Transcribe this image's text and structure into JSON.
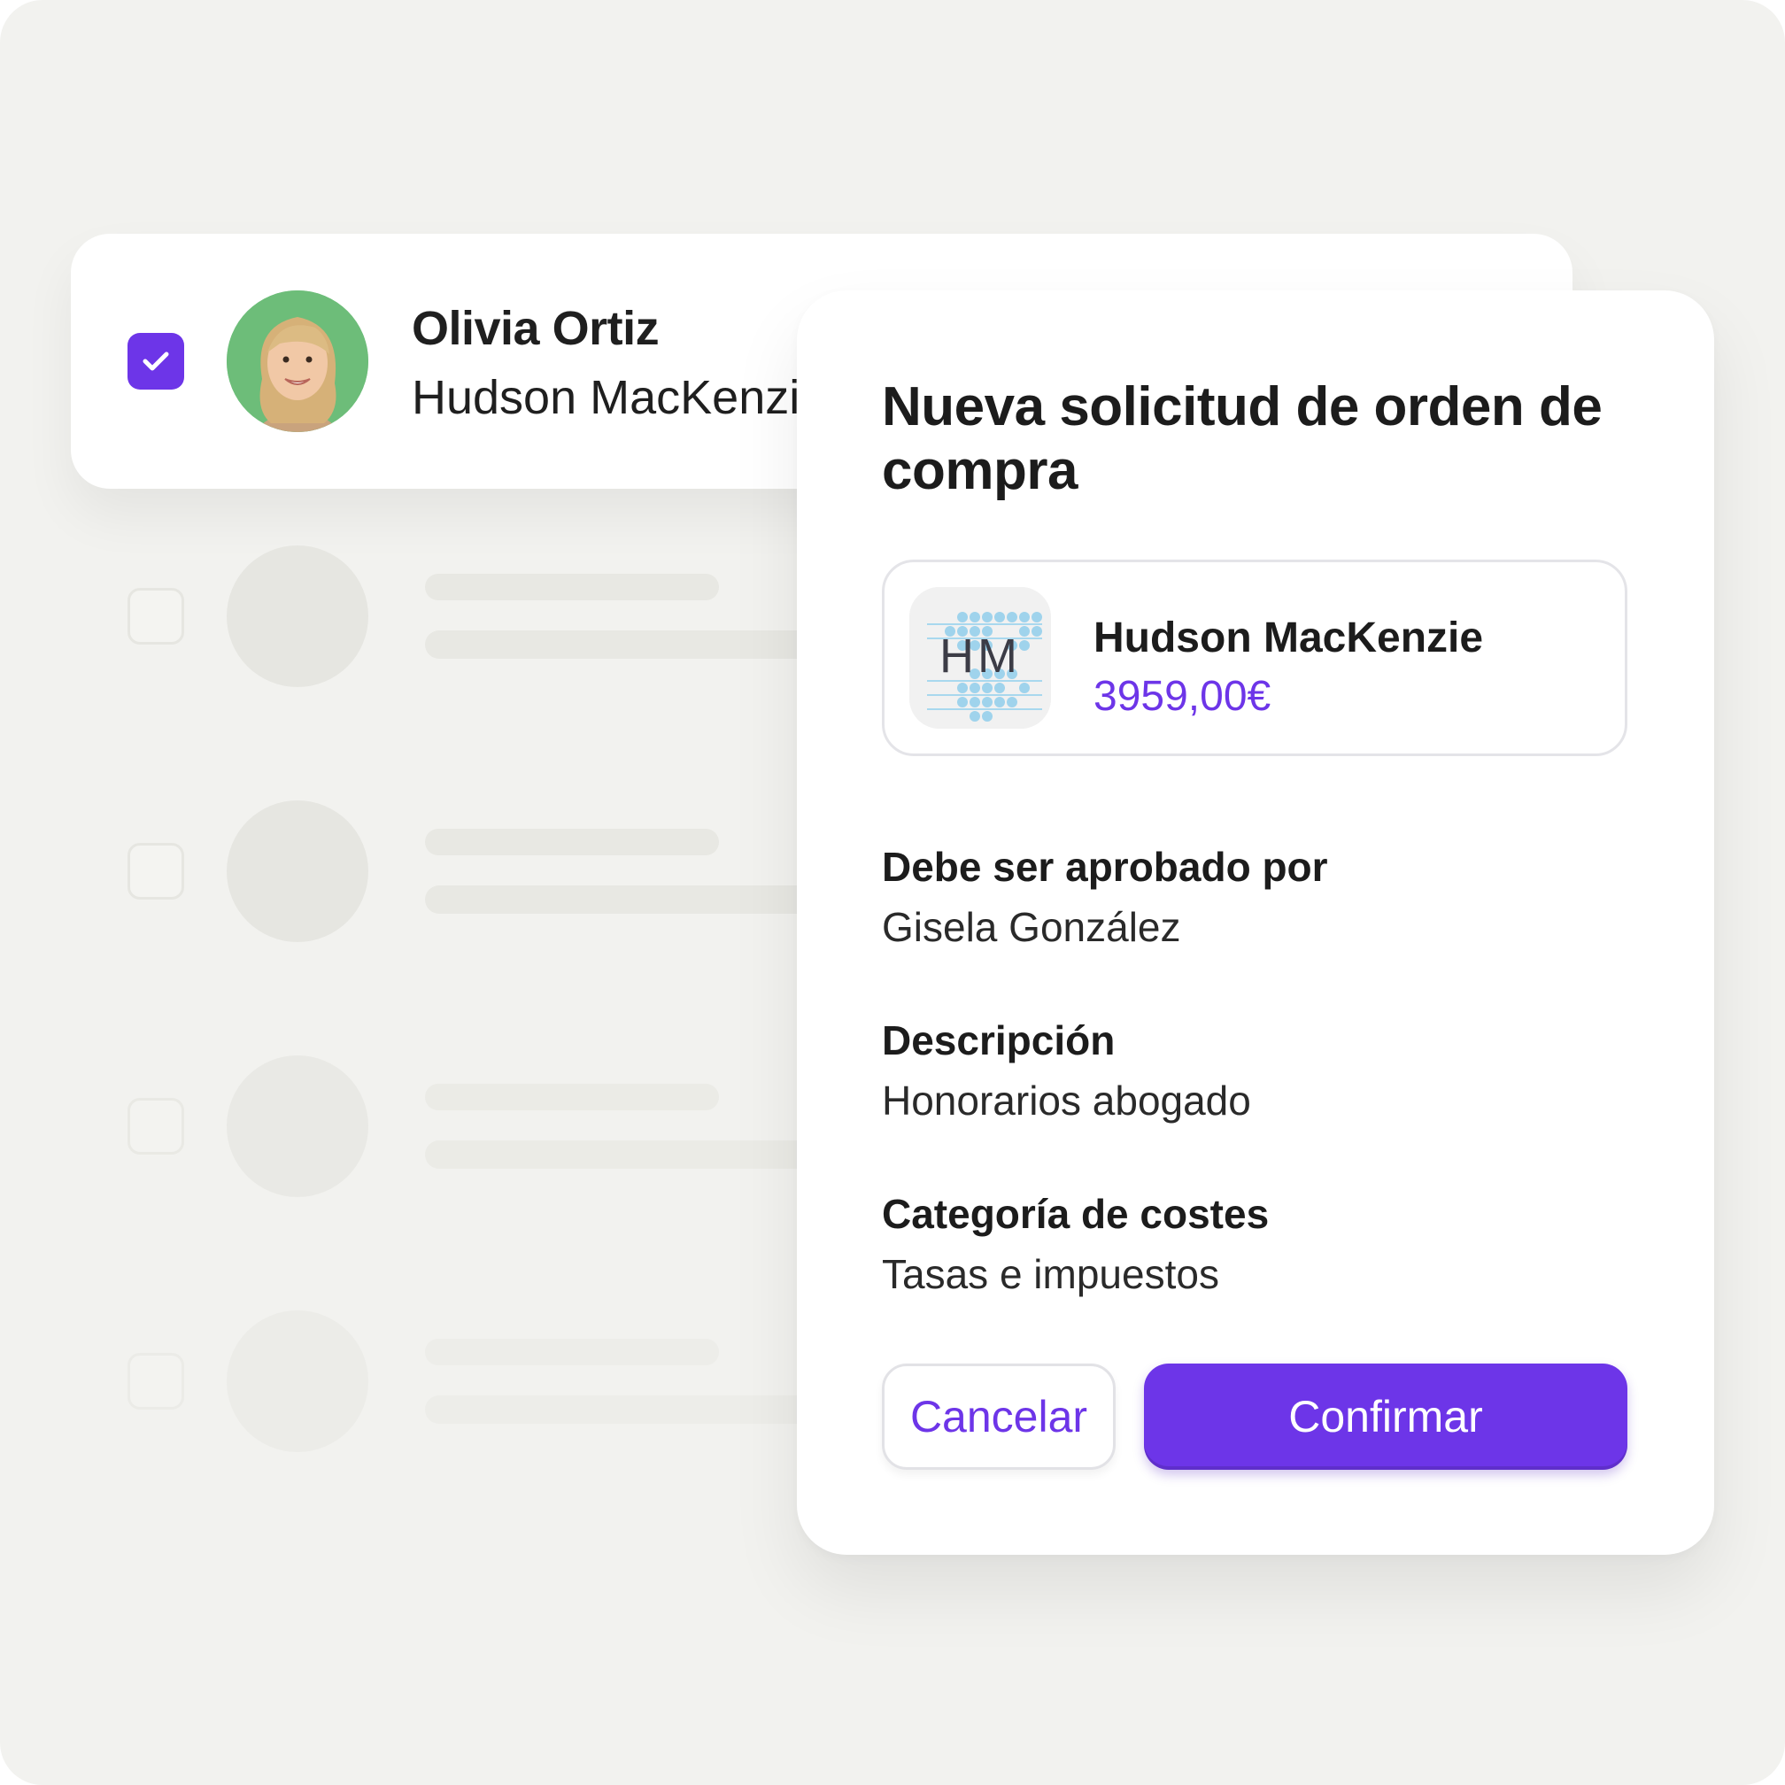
{
  "list": {
    "selected_row": {
      "checked": true,
      "name": "Olivia Ortiz",
      "company": "Hudson MacKenzie"
    },
    "placeholder_rows": 4
  },
  "modal": {
    "title": "Nueva solicitud de orden de compra",
    "vendor": {
      "logo_text": "HM",
      "name": "Hudson MacKenzie",
      "amount": "3959,00€"
    },
    "fields": [
      {
        "label": "Debe ser aprobado por",
        "value": "Gisela González"
      },
      {
        "label": "Descripción",
        "value": "Honorarios abogado"
      },
      {
        "label": "Categoría de costes",
        "value": "Tasas e impuestos"
      }
    ],
    "buttons": {
      "cancel": "Cancelar",
      "confirm": "Confirmar"
    }
  },
  "colors": {
    "accent": "#6d35e8",
    "background": "#f2f2ef",
    "placeholder": "#e8e8e3"
  },
  "icons": {
    "checkbox": "check-icon",
    "avatar": "avatar-photo"
  }
}
